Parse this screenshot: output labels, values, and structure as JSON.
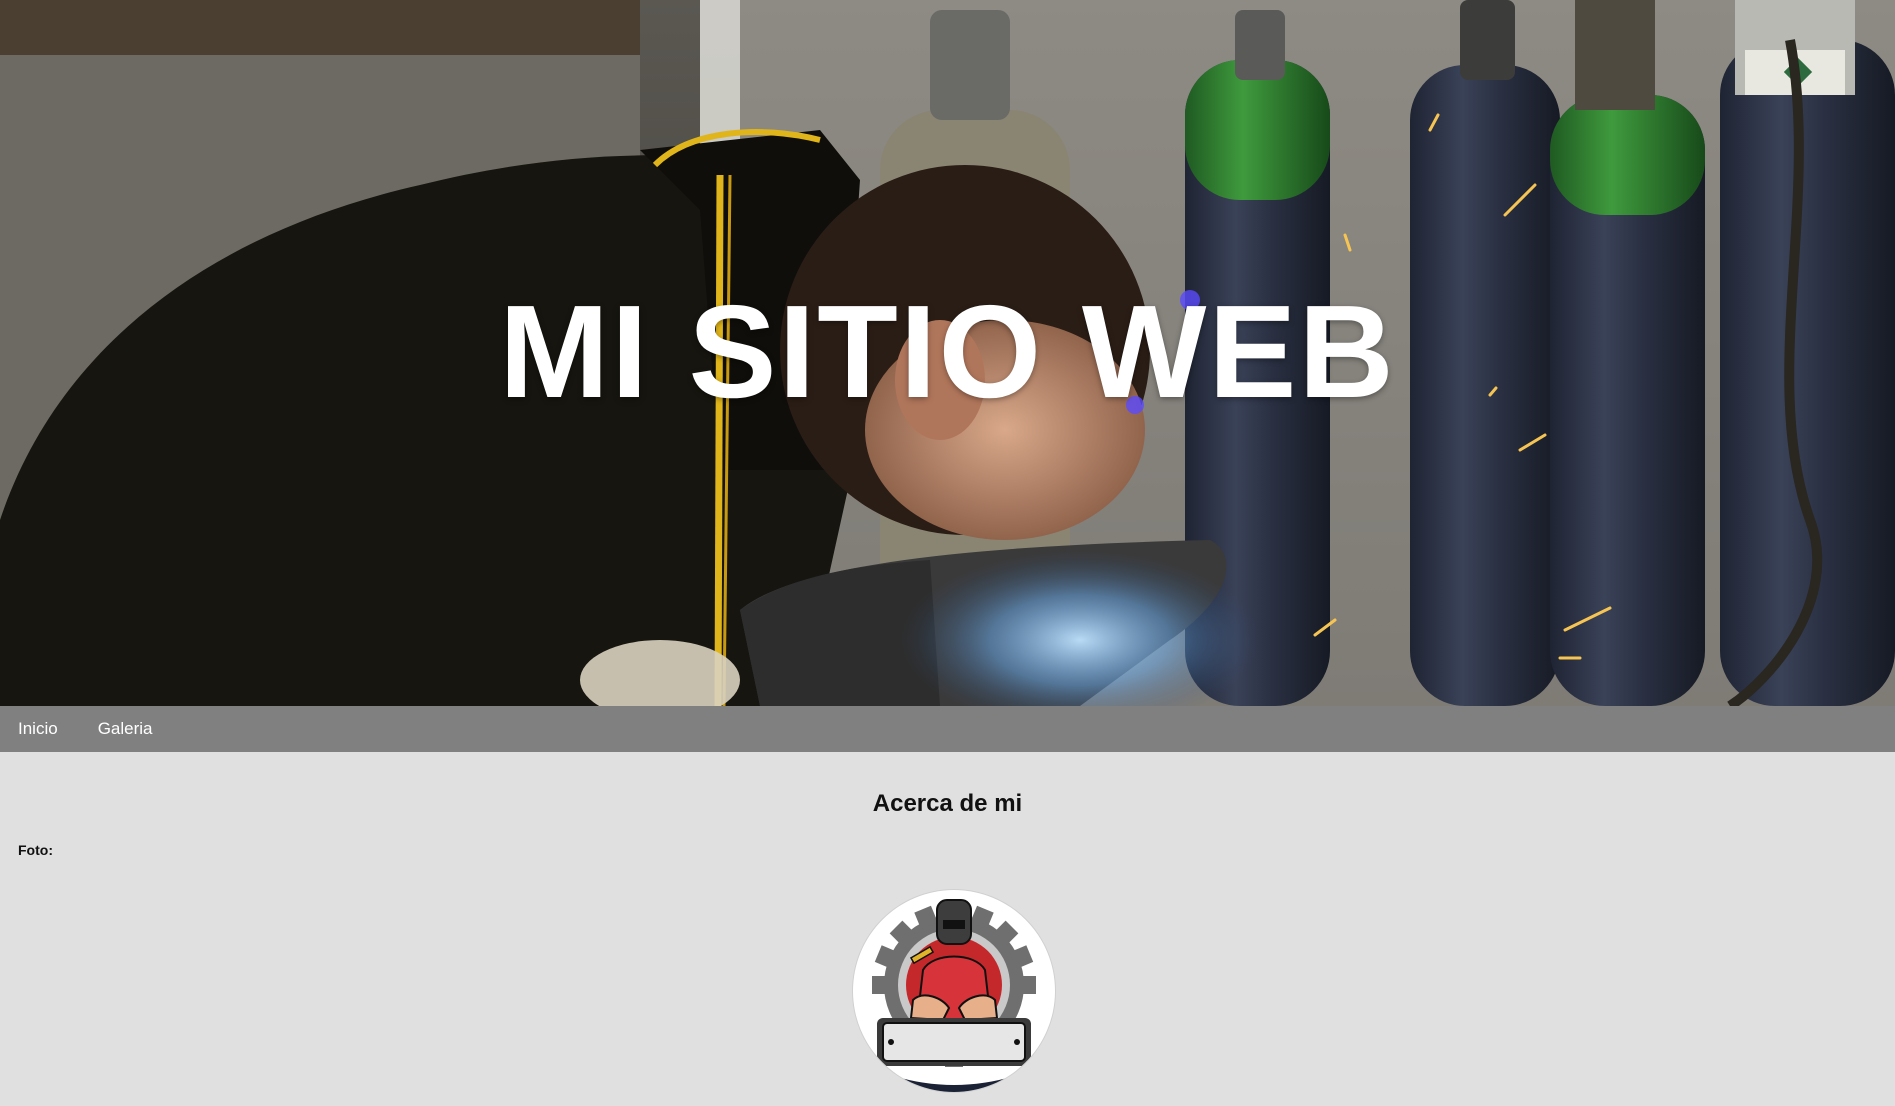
{
  "hero": {
    "title": "MI SITIO WEB"
  },
  "nav": {
    "items": [
      {
        "label": "Inicio"
      },
      {
        "label": "Galeria"
      }
    ]
  },
  "about": {
    "heading": "Acerca de mi",
    "photo_label": "Foto:"
  },
  "colors": {
    "nav_bg": "#808080",
    "page_bg": "#e0e0e0",
    "hero_text": "#ffffff"
  },
  "icons": {
    "avatar": "welder-logo-icon"
  }
}
